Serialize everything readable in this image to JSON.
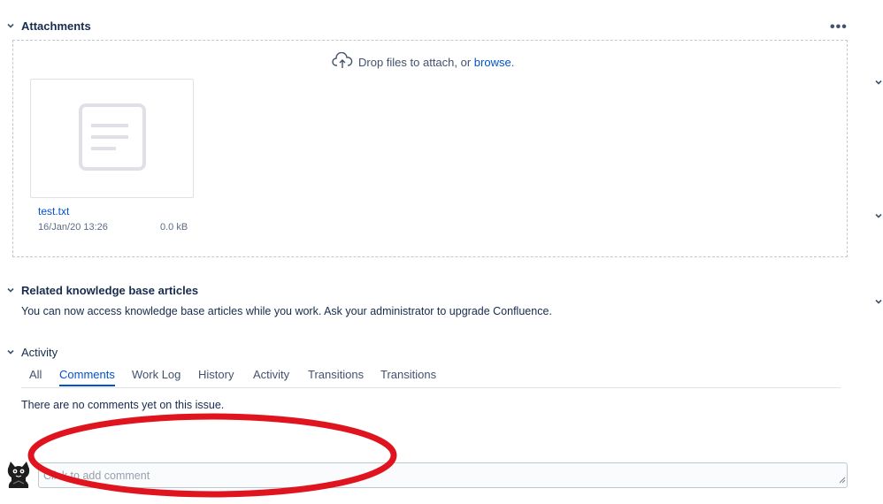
{
  "attachments": {
    "title": "Attachments",
    "more_label": "•••",
    "drop_text": "Drop files to attach, or ",
    "browse_label": "browse",
    "drop_suffix": ".",
    "files": [
      {
        "name": "test.txt",
        "date": "16/Jan/20 13:26",
        "size": "0.0 kB",
        "icon": "document-icon"
      }
    ]
  },
  "knowledge": {
    "title": "Related knowledge base articles",
    "message": "You can now access knowledge base articles while you work. Ask your administrator to upgrade Confluence."
  },
  "activity": {
    "title": "Activity",
    "tabs": [
      {
        "label": "All",
        "active": false
      },
      {
        "label": "Comments",
        "active": true
      },
      {
        "label": "Work Log",
        "active": false
      },
      {
        "label": "History",
        "active": false
      },
      {
        "label": "Activity",
        "active": false
      },
      {
        "label": "Transitions",
        "active": false
      },
      {
        "label": "Transitions",
        "active": false
      }
    ],
    "empty_message": "There are no comments yet on this issue.",
    "comment_placeholder": "Click to add comment"
  },
  "colors": {
    "link": "#0052cc",
    "text": "#172b4d",
    "annotation": "#e0141e"
  }
}
